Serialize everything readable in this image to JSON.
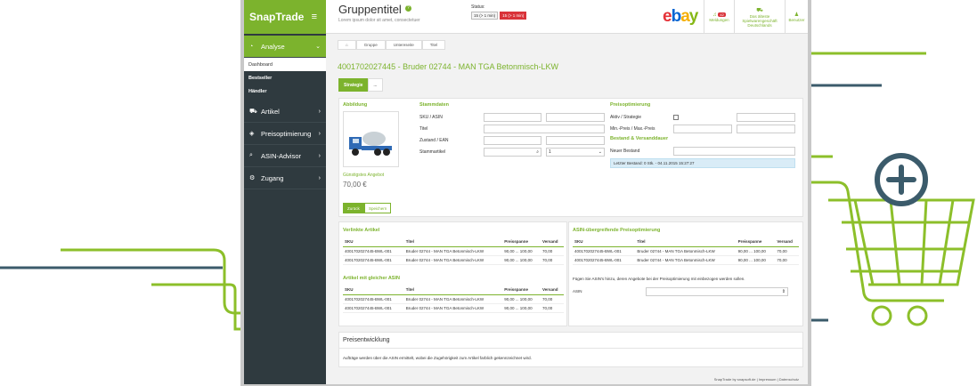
{
  "brand": {
    "name": "SnapTrade",
    "menu_icon": "hamburger-icon"
  },
  "sidebar": {
    "sections": [
      {
        "label": "Analyse",
        "icon": "gauge-icon",
        "active": true,
        "subitems": [
          {
            "label": "Dashboard",
            "active": true
          },
          {
            "label": "Bestseller"
          },
          {
            "label": "Händler"
          }
        ]
      },
      {
        "label": "Artikel",
        "icon": "cart-icon"
      },
      {
        "label": "Preisoptimierung",
        "icon": "tags-icon"
      },
      {
        "label": "ASIN-Advisor",
        "icon": "search-icon"
      },
      {
        "label": "Zugang",
        "icon": "gears-icon"
      }
    ]
  },
  "header": {
    "title": "Gruppentitel",
    "subtitle": "Lorem ipsum dolor sit amet, consectetuer",
    "status_label": "Status:",
    "status_badges": [
      "15 (> 1 min)",
      "15 (> 1 min)"
    ],
    "logo": "ebay",
    "nav": [
      {
        "label": "Meldungen",
        "count": "42"
      },
      {
        "label": "Das älteste Spielwarengeschäft Deutschlands"
      },
      {
        "label": "Benutzer"
      }
    ]
  },
  "breadcrumb": [
    "⌂",
    "Gruppe",
    "Untereseite",
    "Titel"
  ],
  "page_title": "4001702027445 - Bruder 02744 - MAN TGA Betonmisch-LKW",
  "tabs": [
    "Strategie",
    "..."
  ],
  "form": {
    "image_header": "Abbildung",
    "cheapest_label": "Günstigstes Angebot",
    "cheapest_price": "70,00 €",
    "stammdaten_header": "Stammdaten",
    "stammdaten_fields": [
      "SKU / ASIN",
      "Titel",
      "Zustand / EAN",
      "Stammartikel"
    ],
    "stammartikel_select": "1",
    "preis_header": "Preisoptimierung",
    "preis_fields": [
      "Aktiv / Strategie",
      "Min.-Preis / Max.-Preis"
    ],
    "bestand_header": "Bestand & Versanddauer",
    "bestand_field": "Neuer Bestand",
    "bestand_info": "Letzter Bestand: 0 Stk. - 04.11.2015 15:27:27",
    "buttons": {
      "back": "Zurück",
      "save": "Speichern"
    }
  },
  "linked": {
    "header": "Verlinkte Artikel",
    "columns": [
      "SKU",
      "Titel",
      "Preisspanne",
      "Versand"
    ],
    "rows": [
      [
        "4001702027445-BWL-001",
        "Bruder 02744 - MAN TGA Betonmisch-LKW",
        "90,00 ... 100,00",
        "70,00"
      ],
      [
        "4001702027445-BWL-001",
        "Bruder 02744 - MAN TGA Betonmisch-LKW",
        "90,00 ... 100,00",
        "70,00"
      ]
    ]
  },
  "same_asin": {
    "header": "Artikel mit gleicher ASIN",
    "columns": [
      "SKU",
      "Titel",
      "Preisspanne",
      "Versand"
    ],
    "rows": [
      [
        "4001702027445-BWL-001",
        "Bruder 02744 - MAN TGA Betonmisch-LKW",
        "90,00 ... 100,00",
        "70,00"
      ],
      [
        "4001702027445-BWL-001",
        "Bruder 02744 - MAN TGA Betonmisch-LKW",
        "90,00 ... 100,00",
        "70,00"
      ]
    ]
  },
  "asin_opt": {
    "header": "ASIN-übergreifende Preisoptimierung",
    "columns": [
      "SKU",
      "Titel",
      "Preisspanne",
      "Versand"
    ],
    "rows": [
      [
        "4001702027445-BWL-001",
        "Bruder 02744 - MAN TGA Betonmisch-LKW",
        "90,00 ... 100,00",
        "70,00"
      ],
      [
        "4001702027445-BWL-001",
        "Bruder 02744 - MAN TGA Betonmisch-LKW",
        "90,00 ... 100,00",
        "70,00"
      ]
    ],
    "note": "Fügen Sie ASIN's hinzu, deren Angebote bei der Preisoptimierung mit einbezogen werden sollen.",
    "asin_label": "ASIN"
  },
  "price_dev": {
    "header": "Preisentwicklung",
    "text": "Aufträge werden über die ASIN ermittelt, wobei die Zugehörigkeit zum Artikel farblich gekennzeichnet wird."
  },
  "footer": "SnapTrade by snapsoft.de | Impressum | Datenschutz",
  "colors": {
    "accent": "#7cb32d",
    "sidebar": "#2f3a3f",
    "alert": "#d9333a",
    "deco_green": "#8cbf2a",
    "deco_navy": "#3b5b6b"
  }
}
